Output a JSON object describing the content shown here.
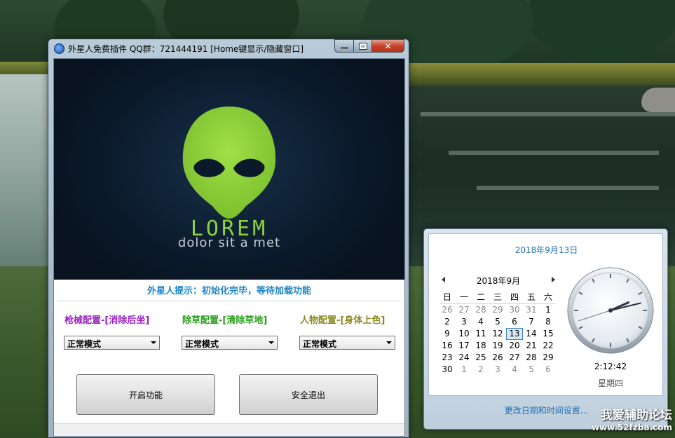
{
  "window": {
    "title": "外星人免费插件 QQ群：721444191 [Home键显示/隐藏窗口]"
  },
  "banner": {
    "brand": "LOREM",
    "tagline": "dolor sit a met",
    "brand_color": "#8dd13c"
  },
  "hint": "外星人提示：初始化完毕，等待加载功能",
  "configs": [
    {
      "label": "枪械配置-[消除后坐]",
      "value": "正常模式",
      "color": "#9b21c4"
    },
    {
      "label": "除草配置-[清除草地]",
      "value": "正常模式",
      "color": "#2aa11d"
    },
    {
      "label": "人物配置-[身体上色]",
      "value": "正常模式",
      "color": "#8b8a1c"
    }
  ],
  "buttons": {
    "start": "开启功能",
    "exit": "安全退出"
  },
  "flyout": {
    "full_date": "2018年9月13日",
    "month_title": "2018年9月",
    "weekdays": [
      "日",
      "一",
      "二",
      "三",
      "四",
      "五",
      "六"
    ],
    "weeks": [
      [
        "26",
        "27",
        "28",
        "29",
        "30",
        "31",
        "1"
      ],
      [
        "2",
        "3",
        "4",
        "5",
        "6",
        "7",
        "8"
      ],
      [
        "9",
        "10",
        "11",
        "12",
        "13",
        "14",
        "15"
      ],
      [
        "16",
        "17",
        "18",
        "19",
        "20",
        "21",
        "22"
      ],
      [
        "23",
        "24",
        "25",
        "26",
        "27",
        "28",
        "29"
      ],
      [
        "30",
        "1",
        "2",
        "3",
        "4",
        "5",
        "6"
      ]
    ],
    "today": "13",
    "time": "2:12:42",
    "weekday_name": "星期四",
    "change_link": "更改日期和时间设置..."
  },
  "watermark": {
    "main": "我爱辅助论坛",
    "url": "www.52fzba.com"
  }
}
